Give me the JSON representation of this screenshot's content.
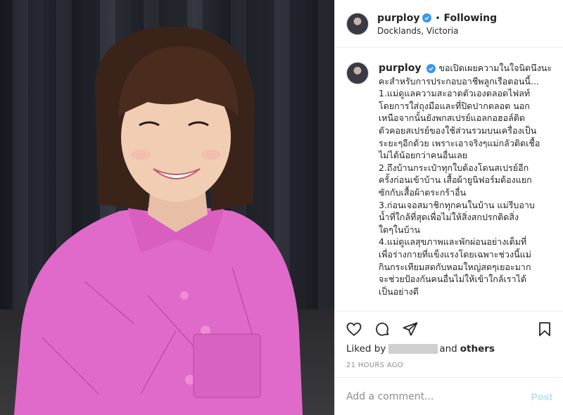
{
  "photo": {
    "alt_subject": "woman in pink uniform smiling"
  },
  "header": {
    "username": "purploy",
    "dot": "•",
    "follow_label": "Following",
    "location": "Docklands, Victoria"
  },
  "caption": {
    "username": "purploy",
    "lines": [
      "ขอเปิดเผยความในใจนิดนึงนะ",
      "คะสำหรับการประกอบอาชีพลูกเรือตอนนี้...",
      "1.แม่ดูแลความสะอาดตัวเองตลอดไฟลท์",
      "โดยการใส่ถุงมือและที่ปิดปากตลอด นอก",
      "เหนือจากนั้นยังพกสเปรย์แอลกอฮอล์ติด",
      "ตัวคอยสเปรย์ของใช้ส่วนรวมบนเครื่องเป็น",
      "ระยะๆอีกด้วย เพราะเอาจริงๆแม่กลัวติดเชื้อ",
      "ไม่ได้น้อยกว่าคนอื่นเลย",
      "2.ถึงบ้านกระเป๋าทุกใบต้องโดนสเปรย์อีก",
      "ครั้งก่อนเข้าบ้าน เสื้อผ้ายูนิฟอร์มต้องแยก",
      "ซักกับเสื้อผ้าตระกร้าอื่น",
      "3.ก่อนเจอสมาชิกทุกคนในบ้าน แม่รีบอาบ",
      "น้ำที่ใกล้ที่สุดเพื่อไม่ให้สิ่งสกปรกติดสิ่ง",
      "ใดๆในบ้าน",
      "4.แม่ดูแลสุขภาพและพักผ่อนอย่างเต็มที่",
      "เพื่อร่างกายที่แข็งแรงโดยเฉพาะช่วงนี้แม่",
      "กินกระเทียมสดกับหอมใหญ่สดๆเยอะมาก",
      "จะช่วยป้องกันคนอื่นไม่ให้เข้าใกล้เราได้",
      "เป็นอย่างดี"
    ]
  },
  "actions": {
    "icons": [
      "heart-icon",
      "comment-icon",
      "share-icon",
      "bookmark-icon"
    ]
  },
  "likes": {
    "prefix": "Liked by",
    "conjunction": "and",
    "others": "others"
  },
  "timestamp": "21 HOURS AGO",
  "add_comment": {
    "placeholder": "Add a comment...",
    "post_label": "Post"
  },
  "colors": {
    "verified": "#3897f0",
    "post_disabled": "#b2dffc",
    "uniform": "#e06ac9"
  }
}
